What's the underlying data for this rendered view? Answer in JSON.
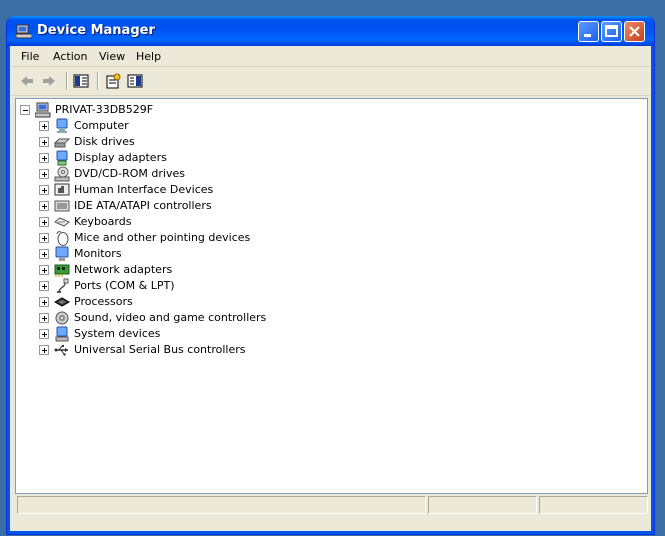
{
  "window": {
    "title": "Device Manager",
    "colors": {
      "titlebar": "#0055ea",
      "close_button": "#c73f1a",
      "face": "#ece9d8"
    }
  },
  "menu": {
    "items": [
      {
        "label": "File"
      },
      {
        "label": "Action"
      },
      {
        "label": "View"
      },
      {
        "label": "Help"
      }
    ]
  },
  "toolbar": {
    "buttons": [
      {
        "icon": "back-arrow-icon"
      },
      {
        "icon": "forward-arrow-icon"
      },
      {
        "icon": "show-hide-console-tree-icon"
      },
      {
        "icon": "properties-icon"
      },
      {
        "icon": "help-pane-icon"
      }
    ]
  },
  "tree": {
    "root": {
      "label": "PRIVAT-33DB529F",
      "icon": "computer-icon",
      "expanded": true
    },
    "categories": [
      {
        "label": "Computer",
        "icon": "computer-icon"
      },
      {
        "label": "Disk drives",
        "icon": "disk-drive-icon"
      },
      {
        "label": "Display adapters",
        "icon": "display-adapter-icon"
      },
      {
        "label": "DVD/CD-ROM drives",
        "icon": "dvd-drive-icon"
      },
      {
        "label": "Human Interface Devices",
        "icon": "hid-icon"
      },
      {
        "label": "IDE ATA/ATAPI controllers",
        "icon": "ide-controller-icon"
      },
      {
        "label": "Keyboards",
        "icon": "keyboard-icon"
      },
      {
        "label": "Mice and other pointing devices",
        "icon": "mouse-icon"
      },
      {
        "label": "Monitors",
        "icon": "monitor-icon"
      },
      {
        "label": "Network adapters",
        "icon": "network-adapter-icon"
      },
      {
        "label": "Ports (COM & LPT)",
        "icon": "port-icon"
      },
      {
        "label": "Processors",
        "icon": "processor-icon"
      },
      {
        "label": "Sound, video and game controllers",
        "icon": "sound-icon"
      },
      {
        "label": "System devices",
        "icon": "system-device-icon"
      },
      {
        "label": "Universal Serial Bus controllers",
        "icon": "usb-icon"
      }
    ]
  }
}
